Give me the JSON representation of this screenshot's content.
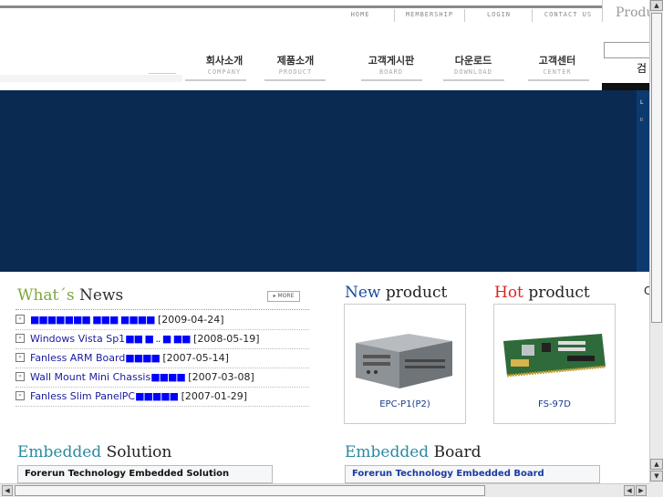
{
  "utility_nav": [
    "HOME",
    "MEMBERSHIP",
    "LOGIN",
    "CONTACT US"
  ],
  "product_tab_label": "Produ",
  "search_button_label": "검",
  "main_nav": [
    {
      "kr": "회사소개",
      "en": "COMPANY"
    },
    {
      "kr": "제품소개",
      "en": "PRODUCT"
    },
    {
      "kr": "고객게시판",
      "en": "BOARD"
    },
    {
      "kr": "다운로드",
      "en": "DOWNLOAD"
    },
    {
      "kr": "고객센터",
      "en": "CENTER"
    }
  ],
  "banner_side": {
    "top": "L",
    "bottom": "ll"
  },
  "news": {
    "title_prefix": "What´s",
    "title_suffix": "News",
    "more_label": "MORE",
    "items": [
      {
        "text": "",
        "blocks": "■■■■■■■ ■■■ ■■■■",
        "date": "[2009-04-24]"
      },
      {
        "text": "Windows Vista Sp1",
        "blocks": "■■ ■ .. ■ ■■",
        "date": "[2008-05-19]"
      },
      {
        "text": "Fanless ARM Board",
        "blocks": "■■■■",
        "date": "[2007-05-14]"
      },
      {
        "text": "Wall Mount Mini Chassis",
        "blocks": "■■■■",
        "date": "[2007-03-08]"
      },
      {
        "text": "Fanless Slim PanelPC",
        "blocks": "■■■■■",
        "date": "[2007-01-29]"
      }
    ]
  },
  "new_product": {
    "title_accent": "New",
    "title_rest": "product",
    "caption": "EPC-P1(P2)"
  },
  "hot_product": {
    "title_accent": "Hot",
    "title_rest": "product",
    "caption": "FS-97D"
  },
  "embedded_solution": {
    "title_accent": "Embedded",
    "title_rest": "Solution",
    "box_label": "Forerun Technology Embedded Solution"
  },
  "embedded_board": {
    "title_accent": "Embedded",
    "title_rest": "Board",
    "box_label": "Forerun Technology Embedded Board"
  },
  "right_cut_text": "C",
  "colors": {
    "banner": "#0a2a52",
    "accent_green": "#7ea83a",
    "accent_red": "#e02020",
    "accent_blue": "#1a4aa0",
    "link_blue": "#1a1aa0"
  }
}
